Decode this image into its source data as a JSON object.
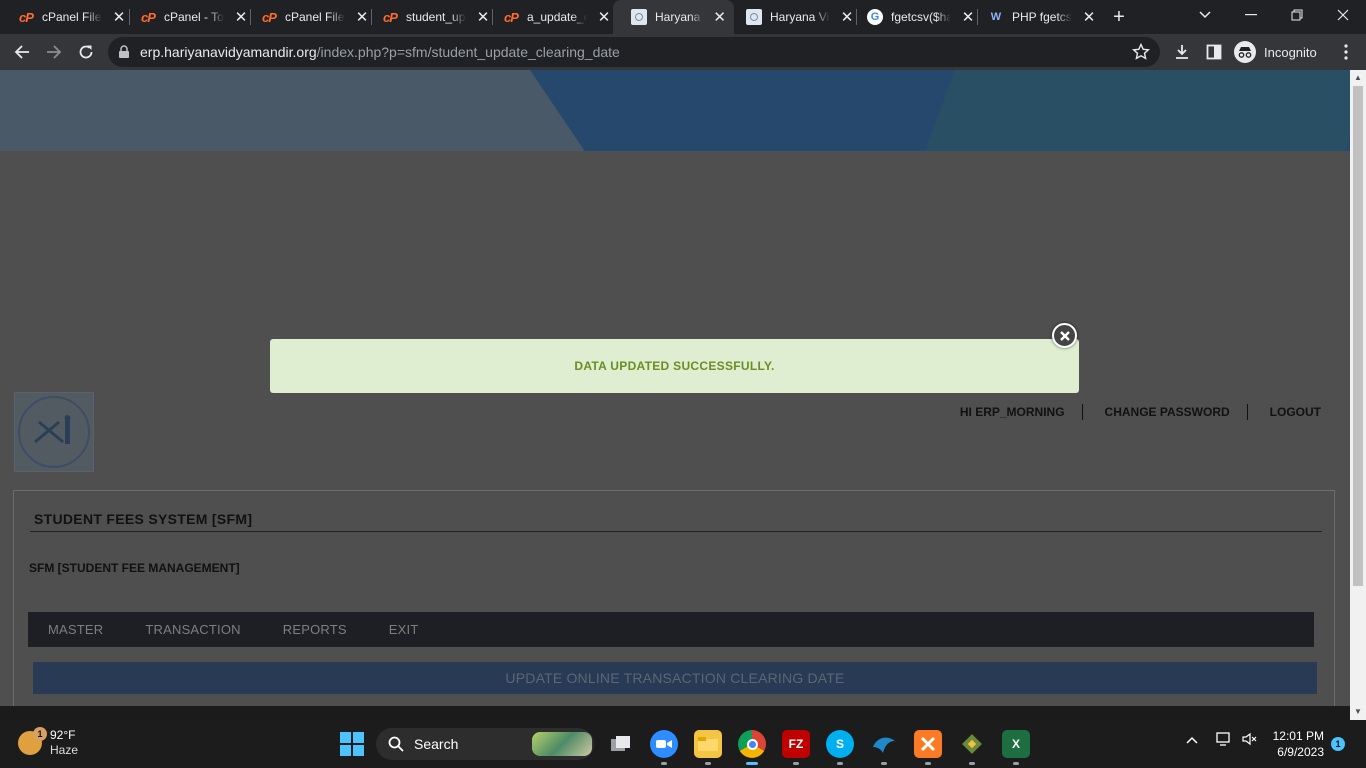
{
  "browser": {
    "tabs": [
      {
        "title": "cPanel File",
        "favicon": "cpanel-icon"
      },
      {
        "title": "cPanel - Tools",
        "favicon": "cpanel-icon"
      },
      {
        "title": "cPanel File",
        "favicon": "cpanel-icon"
      },
      {
        "title": "student_update",
        "favicon": "cpanel-icon"
      },
      {
        "title": "a_update_clearing",
        "favicon": "cpanel-icon"
      },
      {
        "title": "Haryana Vidya",
        "favicon": "document-icon"
      },
      {
        "title": "Haryana Vidya",
        "favicon": "document-icon"
      },
      {
        "title": "fgetcsv($handle",
        "favicon": "google-icon"
      },
      {
        "title": "PHP fgetcsv",
        "favicon": "w3-icon"
      }
    ],
    "active_tab_index": 5,
    "url_host": "erp.hariyanavidyamandir.org",
    "url_path": "/index.php?p=sfm/student_update_clearing_date",
    "profile_label": "Incognito",
    "accent_color": "#35363a"
  },
  "page": {
    "alert": {
      "message": "DATA UPDATED SUCCESSFULLY.",
      "bg_color": "#dfeed0",
      "text_color": "#6b8e23"
    },
    "user_nav": {
      "greeting": "HI ERP_MORNING",
      "change_password": "CHANGE PASSWORD",
      "logout": "LOGOUT"
    },
    "panel": {
      "title": "STUDENT FEES SYSTEM [SFM]",
      "subtitle": "SFM [STUDENT FEE MANAGEMENT]",
      "menu": [
        "MASTER",
        "TRANSACTION",
        "REPORTS",
        "EXIT"
      ],
      "section_title": "UPDATE ONLINE TRANSACTION CLEARING DATE"
    }
  },
  "taskbar": {
    "weather_temp": "92°F",
    "weather_desc": "Haze",
    "weather_badge": "1",
    "search_label": "Search",
    "apps": [
      "task-view-icon",
      "zoom-icon",
      "file-explorer-icon",
      "chrome-icon",
      "filezilla-icon",
      "skype-icon",
      "mysql-workbench-icon",
      "xampp-icon",
      "git-icon",
      "excel-icon"
    ],
    "time": "12:01 PM",
    "date": "6/9/2023",
    "notification_count": "1"
  }
}
